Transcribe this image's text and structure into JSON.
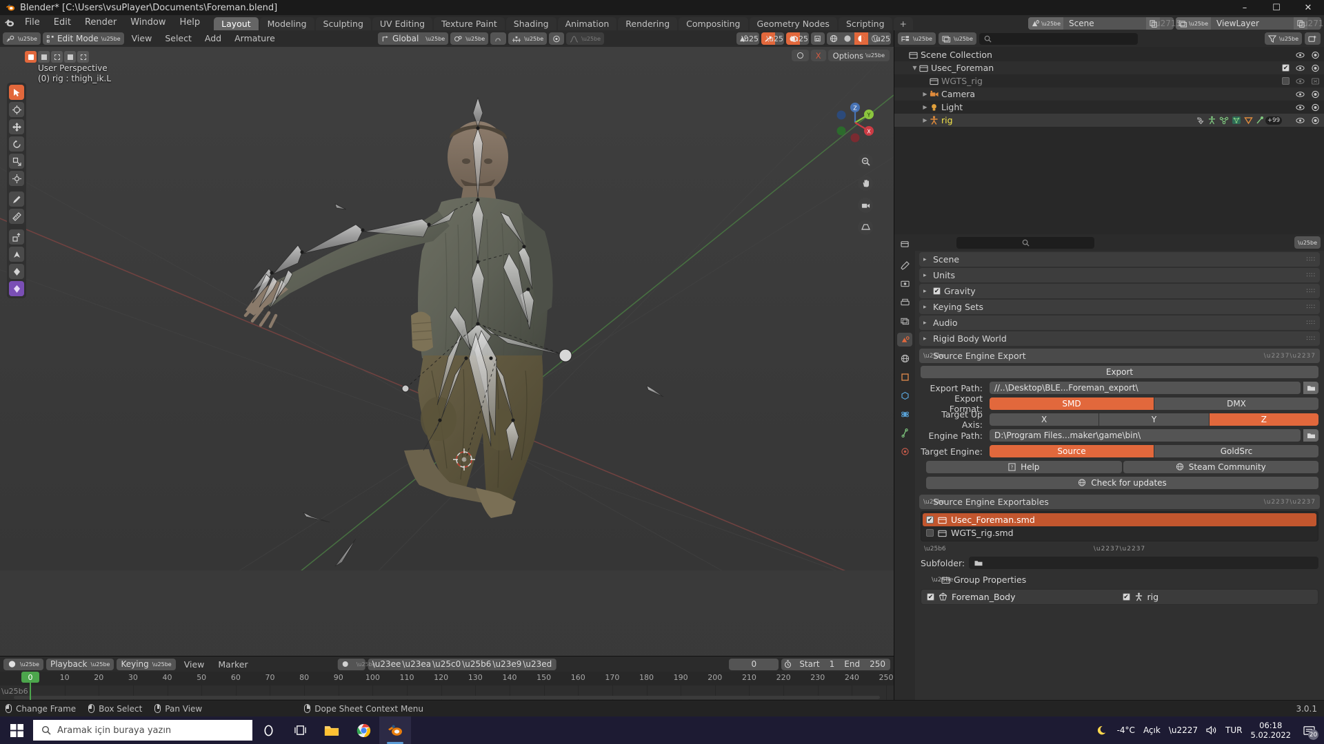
{
  "titlebar": {
    "title": "Blender* [C:\\Users\\vsuPlayer\\Documents\\Foreman.blend]",
    "minimize": "–",
    "maximize": "☐",
    "close": "✕"
  },
  "menubar": {
    "items": [
      "File",
      "Edit",
      "Render",
      "Window",
      "Help"
    ],
    "tabs": [
      {
        "label": "Layout",
        "active": true
      },
      {
        "label": "Modeling",
        "active": false
      },
      {
        "label": "Sculpting",
        "active": false
      },
      {
        "label": "UV Editing",
        "active": false
      },
      {
        "label": "Texture Paint",
        "active": false
      },
      {
        "label": "Shading",
        "active": false
      },
      {
        "label": "Animation",
        "active": false
      },
      {
        "label": "Rendering",
        "active": false
      },
      {
        "label": "Compositing",
        "active": false
      },
      {
        "label": "Geometry Nodes",
        "active": false
      },
      {
        "label": "Scripting",
        "active": false
      }
    ],
    "add_tab": "+",
    "scene_name": "Scene",
    "viewlayer_name": "ViewLayer"
  },
  "viewport": {
    "mode": "Edit Mode",
    "menus": [
      "View",
      "Select",
      "Add",
      "Armature"
    ],
    "transform_orientation": "Global",
    "overlay_line1": "User Perspective",
    "overlay_line2": "(0) rig : thigh_ik.L",
    "options_label": "Options",
    "gizmo_axes": [
      {
        "label": "Z",
        "color": "#4772b3"
      },
      {
        "label": "Y",
        "color": "#8cc63e"
      },
      {
        "label": "X",
        "color": "#cc3b44"
      }
    ]
  },
  "outliner": {
    "rows": [
      {
        "label": "Scene Collection",
        "icon": "collection-icon",
        "depth": 0,
        "arrow": "",
        "checkbox": null,
        "eye": false,
        "camera": false,
        "dim": false,
        "highlight": false
      },
      {
        "label": "Usec_Foreman",
        "icon": "collection-icon",
        "depth": 1,
        "arrow": "▼",
        "checkbox": true,
        "eye": true,
        "camera": true,
        "dim": false,
        "highlight": false
      },
      {
        "label": "WGTS_rig",
        "icon": "collection-icon",
        "depth": 2,
        "arrow": "",
        "checkbox": false,
        "eye": true,
        "camera": true,
        "dim": true,
        "highlight": false
      },
      {
        "label": "Camera",
        "icon": "camera-icon",
        "depth": 2,
        "arrow": "▶",
        "checkbox": null,
        "eye": true,
        "camera": true,
        "dim": false,
        "highlight": false
      },
      {
        "label": "Light",
        "icon": "light-icon",
        "depth": 2,
        "arrow": "▶",
        "checkbox": null,
        "eye": true,
        "camera": true,
        "dim": false,
        "highlight": false
      },
      {
        "label": "rig",
        "icon": "armature-icon",
        "depth": 2,
        "arrow": "▶",
        "checkbox": null,
        "eye": true,
        "camera": true,
        "dim": false,
        "highlight": true,
        "badge": "+99"
      }
    ]
  },
  "properties": {
    "panels": [
      {
        "label": "Scene",
        "open": false,
        "checkbox": null
      },
      {
        "label": "Units",
        "open": false,
        "checkbox": null
      },
      {
        "label": "Gravity",
        "open": false,
        "checkbox": true
      },
      {
        "label": "Keying Sets",
        "open": false,
        "checkbox": null
      },
      {
        "label": "Audio",
        "open": false,
        "checkbox": null
      },
      {
        "label": "Rigid Body World",
        "open": false,
        "checkbox": null
      }
    ],
    "source_engine_export": {
      "title": "Source Engine Export",
      "export_button": "Export",
      "export_path_label": "Export Path:",
      "export_path_value": "//..\\Desktop\\BLE...Foreman_export\\",
      "export_format_label": "Export Format:",
      "export_format_options": [
        "SMD",
        "DMX"
      ],
      "export_format_selected": "SMD",
      "target_up_axis_label": "Target Up Axis:",
      "target_up_axis_options": [
        "X",
        "Y",
        "Z"
      ],
      "target_up_axis_selected": "Z",
      "engine_path_label": "Engine Path:",
      "engine_path_value": "D:\\Program Files...maker\\game\\bin\\",
      "target_engine_label": "Target Engine:",
      "target_engine_options": [
        "Source",
        "GoldSrc"
      ],
      "target_engine_selected": "Source",
      "help_button": "Help",
      "steam_button": "Steam Community",
      "updates_button": "Check for updates"
    },
    "source_engine_exportables": {
      "title": "Source Engine Exportables",
      "items": [
        {
          "label": "Usec_Foreman.smd",
          "checked": true,
          "selected": true
        },
        {
          "label": "WGTS_rig.smd",
          "checked": false,
          "selected": false
        }
      ],
      "subfolder_label": "Subfolder:",
      "subfolder_value": "",
      "group_properties_title": "Group Properties",
      "group_items": [
        {
          "label": "Foreman_Body",
          "checked": true,
          "icon": "mesh-icon"
        },
        {
          "label": "rig",
          "checked": true,
          "icon": "armature-icon"
        }
      ]
    }
  },
  "timeline": {
    "editor_label": "",
    "playback": "Playback",
    "keying": "Keying",
    "menus": [
      "View",
      "Marker"
    ],
    "current_frame": "0",
    "start_label": "Start",
    "start_value": "1",
    "end_label": "End",
    "end_value": "250",
    "ticks": [
      0,
      10,
      20,
      30,
      40,
      50,
      60,
      70,
      80,
      90,
      100,
      110,
      120,
      130,
      140,
      150,
      160,
      170,
      180,
      190,
      200,
      210,
      220,
      230,
      240,
      250
    ],
    "playhead_frame": 0
  },
  "statusbar": {
    "items": [
      {
        "label": "Change Frame",
        "mouse": "left"
      },
      {
        "label": "Box Select",
        "mouse": "left-drag"
      },
      {
        "label": "Pan View",
        "mouse": "middle"
      },
      {
        "label": "Dope Sheet Context Menu",
        "mouse": "right"
      }
    ],
    "version": "3.0.1"
  },
  "taskbar": {
    "search_placeholder": "Aramak için buraya yazın",
    "apps": [
      "cortana-icon",
      "taskview-icon",
      "explorer-icon",
      "chrome-icon",
      "blender-icon"
    ],
    "weather_temp": "-4°C",
    "weather_text": "Açık",
    "language": "TUR",
    "time": "06:18",
    "date": "5.02.2022",
    "notification_count": "20"
  },
  "colors": {
    "accent": "#e2683c",
    "panel": "#303030",
    "header": "#2b2b2b",
    "select_green": "#4ca64c",
    "highlight_yellow": "#f2e34a"
  }
}
